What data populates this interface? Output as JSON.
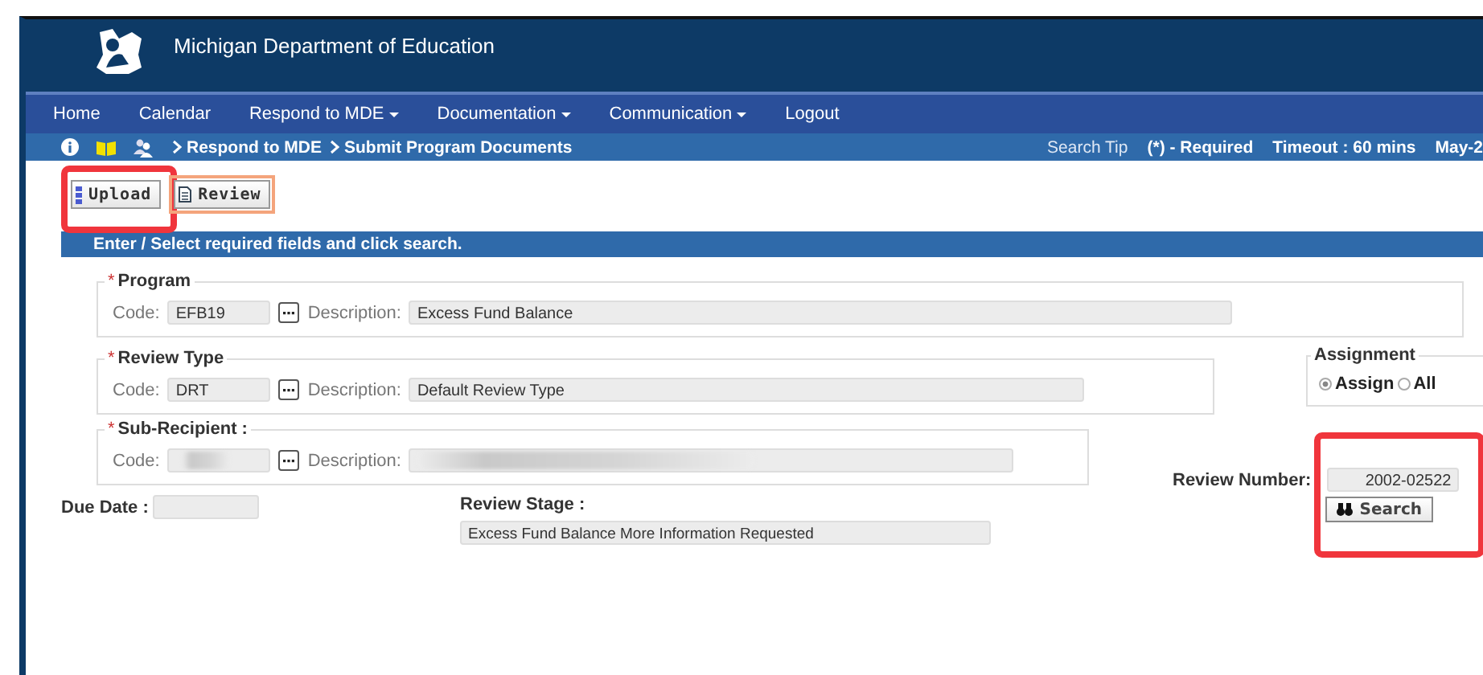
{
  "header": {
    "title": "Michigan Department of Education"
  },
  "nav": [
    {
      "label": "Home",
      "dropdown": false
    },
    {
      "label": "Calendar",
      "dropdown": false
    },
    {
      "label": "Respond to MDE",
      "dropdown": true
    },
    {
      "label": "Documentation",
      "dropdown": true
    },
    {
      "label": "Communication",
      "dropdown": true
    },
    {
      "label": "Logout",
      "dropdown": false
    }
  ],
  "breadcrumb": {
    "items": [
      "Respond to MDE",
      "Submit Program Documents"
    ],
    "info": [
      "Search Tip",
      "(*) - Required",
      "Timeout : 60  mins",
      "May-2"
    ]
  },
  "toolbar": [
    {
      "label": "Upload",
      "kind": "upload",
      "highlighted": true
    },
    {
      "label": "Review",
      "kind": "review",
      "highlighted": false
    }
  ],
  "instruction": "Enter / Select required fields and click search.",
  "program": {
    "legend": "Program",
    "required_mark": "*",
    "code_label": "Code:",
    "code": "EFB19",
    "description_label": "Description:",
    "description": "Excess Fund Balance"
  },
  "review_type": {
    "legend": "Review Type",
    "required_mark": "*",
    "code_label": "Code:",
    "code": "DRT",
    "description_label": "Description:",
    "description": "Default Review Type"
  },
  "sub_recipient": {
    "legend": "Sub-Recipient :",
    "required_mark": "*",
    "code_label": "Code:",
    "description_label": "Description:",
    "redacted": true
  },
  "assignment": {
    "legend": "Assignment",
    "options": [
      {
        "label": "Assign",
        "selected": true
      },
      {
        "label": "All",
        "selected": false
      }
    ]
  },
  "due_date": {
    "label": "Due Date :"
  },
  "review_stage": {
    "label": "Review Stage :",
    "value": "Excess Fund Balance More Information Requested"
  },
  "review_number": {
    "label": "Review Number:",
    "value": "2002-02522",
    "highlighted": true
  },
  "search_button": {
    "label": "Search"
  }
}
